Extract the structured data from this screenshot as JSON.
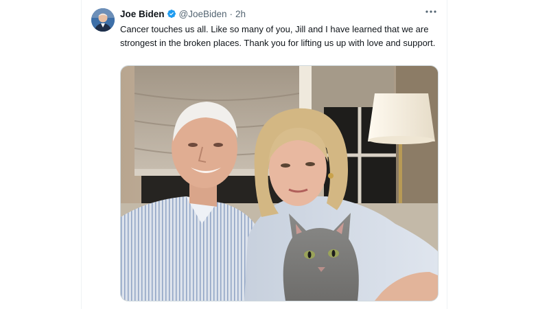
{
  "tweet": {
    "author_name": "Joe Biden",
    "handle": "@JoeBiden",
    "separator": "·",
    "time": "2h",
    "verified": true,
    "text": "Cancer touches us all. Like so many of you, Jill and I have learned that we are strongest in the broken places. Thank you for lifting us up with love and support.",
    "more_icon": "more-horizontal-icon",
    "verified_icon": "verified-badge-icon"
  },
  "colors": {
    "text_primary": "#0f1419",
    "text_secondary": "#536471",
    "verified_blue": "#1d9bf0",
    "border": "#cfd9de"
  }
}
